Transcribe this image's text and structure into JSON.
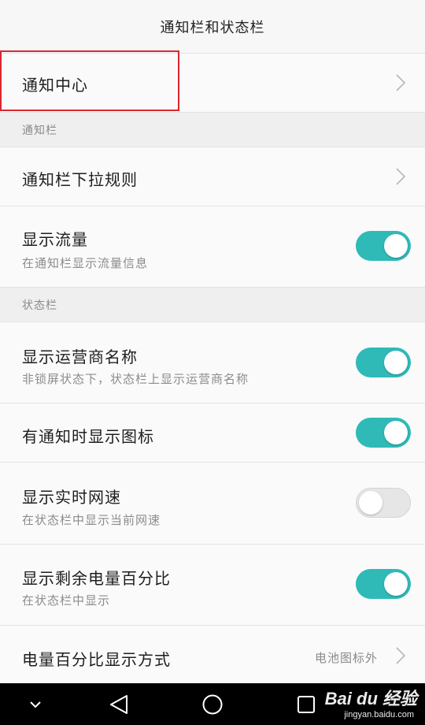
{
  "header": {
    "title": "通知栏和状态栏"
  },
  "rows": {
    "notification_center": {
      "title": "通知中心"
    },
    "section_notification": {
      "label": "通知栏"
    },
    "pull_rule": {
      "title": "通知栏下拉规则"
    },
    "show_traffic": {
      "title": "显示流量",
      "sub": "在通知栏显示流量信息",
      "state": "on"
    },
    "section_status": {
      "label": "状态栏"
    },
    "carrier_name": {
      "title": "显示运营商名称",
      "sub": "非锁屏状态下，状态栏上显示运营商名称",
      "state": "on"
    },
    "notif_icon": {
      "title": "有通知时显示图标",
      "state": "on"
    },
    "net_speed": {
      "title": "显示实时网速",
      "sub": "在状态栏中显示当前网速",
      "state": "off"
    },
    "battery_pct": {
      "title": "显示剩余电量百分比",
      "sub": "在状态栏中显示",
      "state": "on"
    },
    "battery_mode": {
      "title": "电量百分比显示方式",
      "value": "电池图标外"
    }
  },
  "watermark": {
    "brand": "Bai du 经验",
    "site": "jingyan.baidu.com"
  },
  "colors": {
    "accent": "#2fbab8",
    "highlight": "#d9272f",
    "navbar": "#000000"
  },
  "icons": [
    "chevron-right-icon",
    "nav-down-icon",
    "nav-back-icon",
    "nav-home-icon",
    "nav-recents-icon"
  ]
}
